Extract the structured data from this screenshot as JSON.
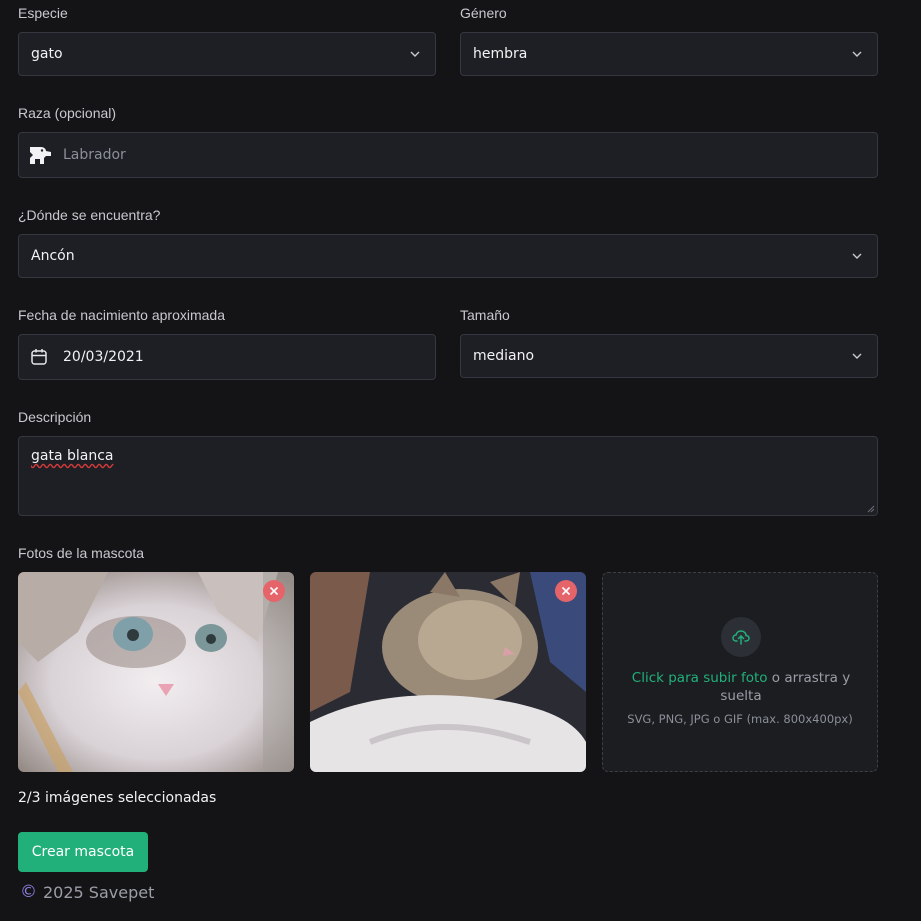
{
  "especie": {
    "label": "Especie",
    "value": "gato"
  },
  "genero": {
    "label": "Género",
    "value": "hembra"
  },
  "raza": {
    "label": "Raza (opcional)",
    "placeholder": "Labrador"
  },
  "ubicacion": {
    "label": "¿Dónde se encuentra?",
    "value": "Ancón"
  },
  "fecha": {
    "label": "Fecha de nacimiento aproximada",
    "value": "20/03/2021"
  },
  "tamano": {
    "label": "Tamaño",
    "value": "mediano"
  },
  "descripcion": {
    "label": "Descripción",
    "value": "gata blanca"
  },
  "fotos": {
    "label": "Fotos de la mascota",
    "upload_link": "Click para subir foto",
    "upload_rest": " o arrastra y suelta",
    "upload_hint": "SVG, PNG, JPG o GIF (max. 800x400px)",
    "count_text": "2/3 imágenes seleccionadas"
  },
  "submit_label": "Crear mascota",
  "footer": {
    "copyright_symbol": "©",
    "text": "2025 Savepet"
  },
  "colors": {
    "accent": "#22b07a",
    "remove": "#e5646a",
    "footer": "#8f7fe0"
  },
  "icons": [
    "chevron-down-icon",
    "dog-icon",
    "calendar-icon",
    "close-icon",
    "upload-cloud-icon",
    "copyright-icon"
  ]
}
